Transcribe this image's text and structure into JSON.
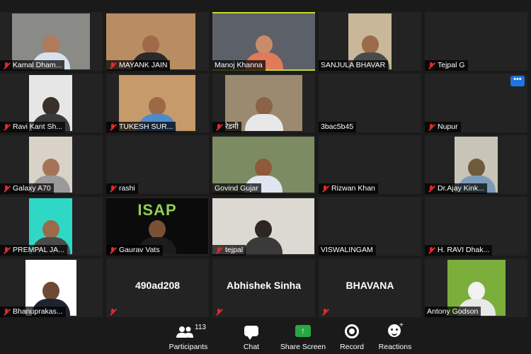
{
  "participants": [
    {
      "name": "Kamal Dham...",
      "muted": true,
      "video": true,
      "bg": "#8a8a86",
      "skin": "#b07b5a",
      "shirt": "#d8e2ee"
    },
    {
      "name": "MAYANK JAIN",
      "muted": true,
      "video": true,
      "bg": "#b98d62",
      "skin": "#a06a4a",
      "shirt": "#2a2a2a"
    },
    {
      "name": "Manoj Khanna",
      "muted": false,
      "video": true,
      "active": true,
      "bg": "#5c6068",
      "skin": "#c98c6b",
      "shirt": "#e07a5a"
    },
    {
      "name": "SANJULA BHAVAR",
      "muted": false,
      "video": true,
      "bg": "#c9b79a",
      "skin": "#9b6b4b",
      "shirt": "#4a4a4a"
    },
    {
      "name": "Tejpal  G",
      "muted": true,
      "video": false
    },
    {
      "name": "Ravi Kant Sh...",
      "muted": true,
      "video": true,
      "bg": "#e6e6e6",
      "skin": "#3a2f2a",
      "shirt": "#3a3a3a"
    },
    {
      "name": "TUKESH SUR...",
      "muted": true,
      "video": true,
      "bg": "#c69a6a",
      "skin": "#9c6847",
      "shirt": "#4f8ac9"
    },
    {
      "name": "रेडमी",
      "muted": true,
      "video": true,
      "bg": "#9b8a70",
      "skin": "#8a6348",
      "shirt": "#e8e8e8"
    },
    {
      "name": "3bac5b45",
      "muted": false,
      "video": false
    },
    {
      "name": "Nupur",
      "muted": true,
      "video": false,
      "menu": true
    },
    {
      "name": "Galaxy A70",
      "muted": true,
      "video": true,
      "bg": "#d8d2c8",
      "skin": "#a47458",
      "shirt": "#9a9a9a"
    },
    {
      "name": "rashi",
      "muted": true,
      "video": false
    },
    {
      "name": "Govind Gujar",
      "muted": false,
      "video": true,
      "bg": "#7d8b62",
      "skin": "#8d5a3c",
      "shirt": "#dfe6f0"
    },
    {
      "name": "Rizwan Khan",
      "muted": true,
      "video": false
    },
    {
      "name": "Dr.Ajay  Kink...",
      "muted": true,
      "video": true,
      "bg": "#c8c5b8",
      "skin": "#6f5a3c",
      "shirt": "#7d9bb8"
    },
    {
      "name": "PREMPAL JA...",
      "muted": true,
      "video": true,
      "bg": "#2fd8c4",
      "skin": "#9a6a4a",
      "shirt": "#4a4a4a"
    },
    {
      "name": "Gaurav Vats",
      "muted": true,
      "video": true,
      "logo": "ISAP",
      "bg": "#0b0b0b",
      "skin": "#7a5035",
      "shirt": "#1c1c1c"
    },
    {
      "name": "tejpal",
      "muted": true,
      "video": true,
      "bg": "#dcd8d2",
      "skin": "#2e2622",
      "shirt": "#3a3a3a"
    },
    {
      "name": "VISWALINGAM",
      "muted": false,
      "video": false
    },
    {
      "name": "H. RAVI Dhak...",
      "muted": true,
      "video": false
    },
    {
      "name": "Bhanuprakas...",
      "muted": true,
      "video": true,
      "bg": "#ffffff",
      "skin": "#6d4a34",
      "shirt": "#1f2230"
    },
    {
      "name": "",
      "big_name": "490ad208",
      "muted": true,
      "video": false
    },
    {
      "name": "",
      "big_name": "Abhishek Sinha",
      "muted": true,
      "video": false
    },
    {
      "name": "",
      "big_name": "BHAVANA",
      "muted": true,
      "video": false
    },
    {
      "name": "Antony Godson",
      "muted": false,
      "video": true,
      "bg": "#7cae3c",
      "skin": "#f2f2f2",
      "shirt": "#e8e8e8",
      "kitten": true
    }
  ],
  "toolbar": {
    "participants_label": "Participants",
    "participants_count": "113",
    "chat_label": "Chat",
    "share_label": "Share Screen",
    "record_label": "Record",
    "reactions_label": "Reactions"
  },
  "colors": {
    "accent": "#c7d92c",
    "share": "#28a745",
    "muted": "#e02a2a",
    "more": "#1f74e0"
  }
}
